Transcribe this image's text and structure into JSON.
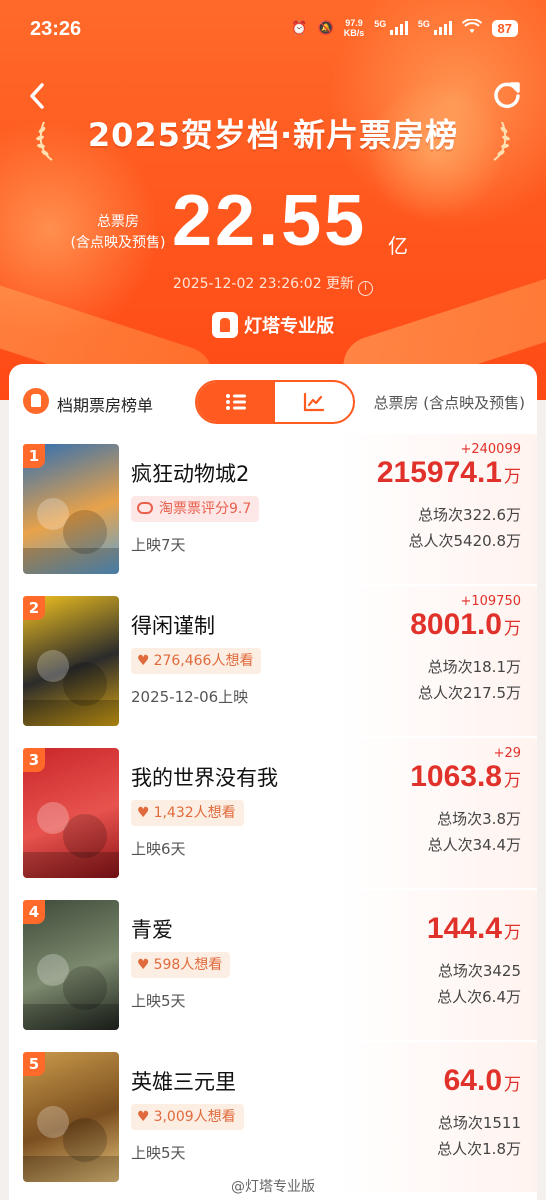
{
  "status_bar": {
    "time": "23:26",
    "net_speed_value": "97.9",
    "net_speed_unit": "KB/s",
    "sig1": "5G",
    "sig2": "5G",
    "battery": "87"
  },
  "header": {
    "title": "2025贺岁档·新片票房榜",
    "total_label_line1": "总票房",
    "total_label_line2": "(含点映及预售)",
    "total_value": "22.55",
    "total_unit": "亿",
    "update_time": "2025-12-02 23:26:02 更新",
    "brand": "灯塔专业版"
  },
  "card": {
    "title": "档期票房榜单",
    "right_label": "总票房 (含点映及预售)",
    "view_list_icon": "list-icon",
    "view_chart_icon": "trend-chart-icon"
  },
  "movies": [
    {
      "rank": "1",
      "title": "疯狂动物城2",
      "tag": "淘票票评分9.7",
      "tag_type": "rating",
      "sub": "上映7天",
      "delta": "+240099",
      "box_value": "215974.1",
      "box_unit": "万",
      "screenings": "总场次322.6万",
      "admissions": "总人次5420.8万",
      "poster_colors": [
        "#2f6fb3",
        "#e8a24a",
        "#5aa1d6"
      ]
    },
    {
      "rank": "2",
      "title": "得闲谨制",
      "tag": "276,466人想看",
      "tag_type": "wish",
      "sub": "2025-12-06上映",
      "delta": "+109750",
      "box_value": "8001.0",
      "box_unit": "万",
      "screenings": "总场次18.1万",
      "admissions": "总人次217.5万",
      "poster_colors": [
        "#f2c21f",
        "#2b2b2b",
        "#d9a514"
      ]
    },
    {
      "rank": "3",
      "title": "我的世界没有我",
      "tag": "1,432人想看",
      "tag_type": "wish",
      "sub": "上映6天",
      "delta": "+29",
      "box_value": "1063.8",
      "box_unit": "万",
      "screenings": "总场次3.8万",
      "admissions": "总人次34.4万",
      "poster_colors": [
        "#c9262a",
        "#e8534e",
        "#8f1418"
      ]
    },
    {
      "rank": "4",
      "title": "青爱",
      "tag": "598人想看",
      "tag_type": "wish",
      "sub": "上映5天",
      "delta": "",
      "box_value": "144.4",
      "box_unit": "万",
      "screenings": "总场次3425",
      "admissions": "总人次6.4万",
      "poster_colors": [
        "#3d4b3a",
        "#7c8a6e",
        "#20261f"
      ]
    },
    {
      "rank": "5",
      "title": "英雄三元里",
      "tag": "3,009人想看",
      "tag_type": "wish",
      "sub": "上映5天",
      "delta": "",
      "box_value": "64.0",
      "box_unit": "万",
      "screenings": "总场次1511",
      "admissions": "总人次1.8万",
      "poster_colors": [
        "#c99a4a",
        "#7a4e1f",
        "#e6c27a"
      ]
    }
  ],
  "watermark": "@灯塔专业版"
}
